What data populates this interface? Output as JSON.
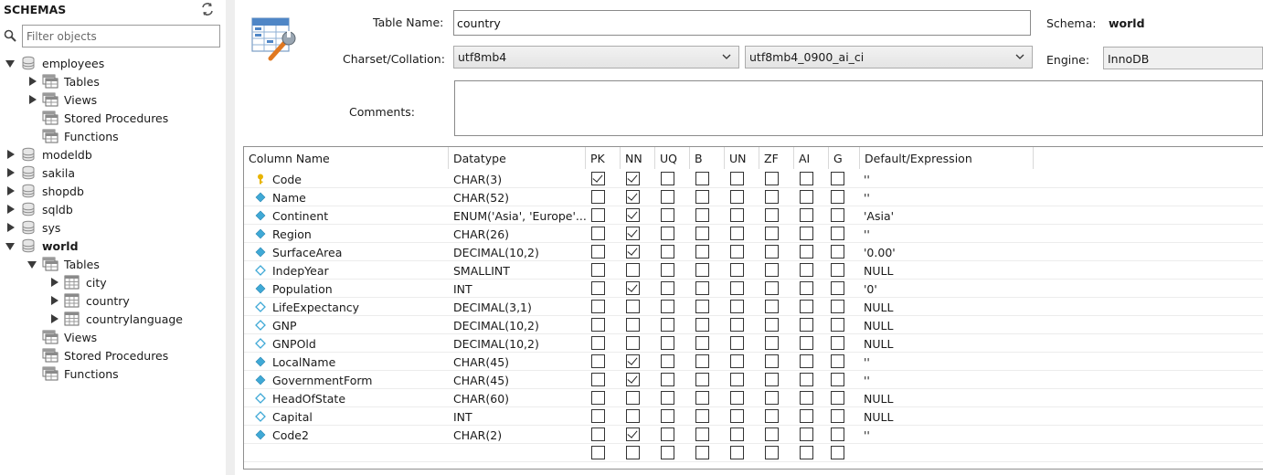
{
  "sidebar": {
    "header": "SCHEMAS",
    "filter_placeholder": "Filter objects",
    "tree": [
      {
        "label": "employees",
        "type": "schema",
        "indent": 0,
        "toggle": "open",
        "bold": false
      },
      {
        "label": "Tables",
        "type": "folder",
        "indent": 1,
        "toggle": "closed",
        "bold": false
      },
      {
        "label": "Views",
        "type": "folder",
        "indent": 1,
        "toggle": "closed",
        "bold": false
      },
      {
        "label": "Stored Procedures",
        "type": "folder",
        "indent": 1,
        "toggle": "none",
        "bold": false
      },
      {
        "label": "Functions",
        "type": "folder",
        "indent": 1,
        "toggle": "none",
        "bold": false
      },
      {
        "label": "modeldb",
        "type": "schema",
        "indent": 0,
        "toggle": "closed",
        "bold": false
      },
      {
        "label": "sakila",
        "type": "schema",
        "indent": 0,
        "toggle": "closed",
        "bold": false
      },
      {
        "label": "shopdb",
        "type": "schema",
        "indent": 0,
        "toggle": "closed",
        "bold": false
      },
      {
        "label": "sqldb",
        "type": "schema",
        "indent": 0,
        "toggle": "closed",
        "bold": false
      },
      {
        "label": "sys",
        "type": "schema",
        "indent": 0,
        "toggle": "closed",
        "bold": false
      },
      {
        "label": "world",
        "type": "schema",
        "indent": 0,
        "toggle": "open",
        "bold": true
      },
      {
        "label": "Tables",
        "type": "folder",
        "indent": 1,
        "toggle": "open",
        "bold": false
      },
      {
        "label": "city",
        "type": "table",
        "indent": 2,
        "toggle": "closed",
        "bold": false
      },
      {
        "label": "country",
        "type": "table",
        "indent": 2,
        "toggle": "closed",
        "bold": false
      },
      {
        "label": "countrylanguage",
        "type": "table",
        "indent": 2,
        "toggle": "closed",
        "bold": false
      },
      {
        "label": "Views",
        "type": "folder",
        "indent": 1,
        "toggle": "none",
        "bold": false
      },
      {
        "label": "Stored Procedures",
        "type": "folder",
        "indent": 1,
        "toggle": "none",
        "bold": false
      },
      {
        "label": "Functions",
        "type": "folder",
        "indent": 1,
        "toggle": "none",
        "bold": false
      }
    ]
  },
  "editor": {
    "table_name_label": "Table Name:",
    "table_name_value": "country",
    "schema_label": "Schema:",
    "schema_value": "world",
    "charset_label": "Charset/Collation:",
    "charset_value": "utf8mb4",
    "collation_value": "utf8mb4_0900_ai_ci",
    "engine_label": "Engine:",
    "engine_value": "InnoDB",
    "comments_label": "Comments:",
    "comments_value": ""
  },
  "grid": {
    "headers": [
      "Column Name",
      "Datatype",
      "PK",
      "NN",
      "UQ",
      "B",
      "UN",
      "ZF",
      "AI",
      "G",
      "Default/Expression"
    ],
    "rows": [
      {
        "name": "Code",
        "datatype": "CHAR(3)",
        "flags": [
          1,
          1,
          0,
          0,
          0,
          0,
          0,
          0
        ],
        "default": "''",
        "key": "pk"
      },
      {
        "name": "Name",
        "datatype": "CHAR(52)",
        "flags": [
          0,
          1,
          0,
          0,
          0,
          0,
          0,
          0
        ],
        "default": "''",
        "key": "col"
      },
      {
        "name": "Continent",
        "datatype": "ENUM('Asia', 'Europe'...",
        "flags": [
          0,
          1,
          0,
          0,
          0,
          0,
          0,
          0
        ],
        "default": "'Asia'",
        "key": "col"
      },
      {
        "name": "Region",
        "datatype": "CHAR(26)",
        "flags": [
          0,
          1,
          0,
          0,
          0,
          0,
          0,
          0
        ],
        "default": "''",
        "key": "col"
      },
      {
        "name": "SurfaceArea",
        "datatype": "DECIMAL(10,2)",
        "flags": [
          0,
          1,
          0,
          0,
          0,
          0,
          0,
          0
        ],
        "default": "'0.00'",
        "key": "col"
      },
      {
        "name": "IndepYear",
        "datatype": "SMALLINT",
        "flags": [
          0,
          0,
          0,
          0,
          0,
          0,
          0,
          0
        ],
        "default": "NULL",
        "key": "nullcol"
      },
      {
        "name": "Population",
        "datatype": "INT",
        "flags": [
          0,
          1,
          0,
          0,
          0,
          0,
          0,
          0
        ],
        "default": "'0'",
        "key": "col"
      },
      {
        "name": "LifeExpectancy",
        "datatype": "DECIMAL(3,1)",
        "flags": [
          0,
          0,
          0,
          0,
          0,
          0,
          0,
          0
        ],
        "default": "NULL",
        "key": "nullcol"
      },
      {
        "name": "GNP",
        "datatype": "DECIMAL(10,2)",
        "flags": [
          0,
          0,
          0,
          0,
          0,
          0,
          0,
          0
        ],
        "default": "NULL",
        "key": "nullcol"
      },
      {
        "name": "GNPOld",
        "datatype": "DECIMAL(10,2)",
        "flags": [
          0,
          0,
          0,
          0,
          0,
          0,
          0,
          0
        ],
        "default": "NULL",
        "key": "nullcol"
      },
      {
        "name": "LocalName",
        "datatype": "CHAR(45)",
        "flags": [
          0,
          1,
          0,
          0,
          0,
          0,
          0,
          0
        ],
        "default": "''",
        "key": "col"
      },
      {
        "name": "GovernmentForm",
        "datatype": "CHAR(45)",
        "flags": [
          0,
          1,
          0,
          0,
          0,
          0,
          0,
          0
        ],
        "default": "''",
        "key": "col"
      },
      {
        "name": "HeadOfState",
        "datatype": "CHAR(60)",
        "flags": [
          0,
          0,
          0,
          0,
          0,
          0,
          0,
          0
        ],
        "default": "NULL",
        "key": "nullcol"
      },
      {
        "name": "Capital",
        "datatype": "INT",
        "flags": [
          0,
          0,
          0,
          0,
          0,
          0,
          0,
          0
        ],
        "default": "NULL",
        "key": "nullcol"
      },
      {
        "name": "Code2",
        "datatype": "CHAR(2)",
        "flags": [
          0,
          1,
          0,
          0,
          0,
          0,
          0,
          0
        ],
        "default": "''",
        "key": "col"
      },
      {
        "name": "",
        "datatype": "",
        "flags": [
          0,
          0,
          0,
          0,
          0,
          0,
          0,
          0
        ],
        "default": "",
        "key": "none"
      }
    ]
  },
  "colors": {
    "key_gold": "#e8b400",
    "diamond_blue": "#3fa9d6",
    "diamond_empty": "#ffffff",
    "icon_gray": "#8a8a8a"
  }
}
